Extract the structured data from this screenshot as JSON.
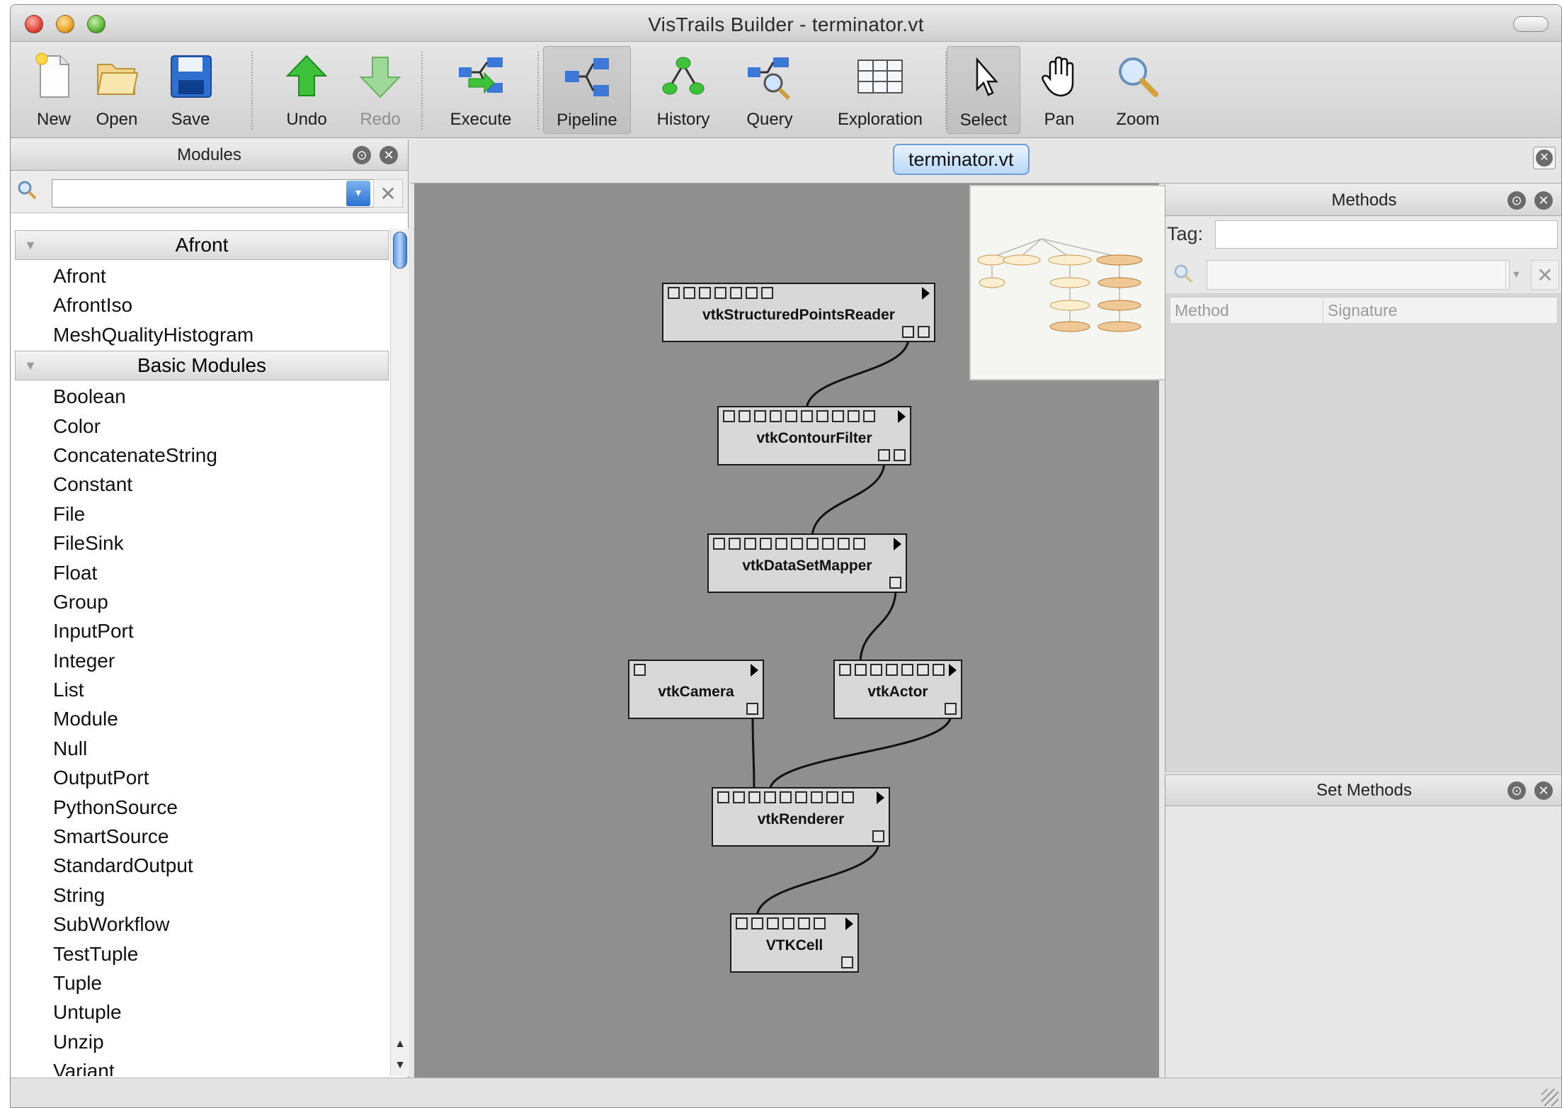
{
  "window": {
    "title": "VisTrails Builder - terminator.vt"
  },
  "toolbar": {
    "new": "New",
    "open": "Open",
    "save": "Save",
    "undo": "Undo",
    "redo": "Redo",
    "execute": "Execute",
    "pipeline": "Pipeline",
    "history": "History",
    "query": "Query",
    "exploration": "Exploration",
    "select": "Select",
    "pan": "Pan",
    "zoom": "Zoom",
    "active_view": "Pipeline",
    "disabled": [
      "Redo"
    ]
  },
  "modules_panel": {
    "title": "Modules",
    "search_value": "",
    "categories": [
      {
        "name": "Afront",
        "items": [
          "Afront",
          "AfrontIso",
          "MeshQualityHistogram"
        ]
      },
      {
        "name": "Basic Modules",
        "items": [
          "Boolean",
          "Color",
          "ConcatenateString",
          "Constant",
          "File",
          "FileSink",
          "Float",
          "Group",
          "InputPort",
          "Integer",
          "List",
          "Module",
          "Null",
          "OutputPort",
          "PythonSource",
          "SmartSource",
          "StandardOutput",
          "String",
          "SubWorkflow",
          "TestTuple",
          "Tuple",
          "Untuple",
          "Unzip",
          "Variant"
        ]
      }
    ]
  },
  "document_tab": {
    "label": "terminator.vt"
  },
  "pipeline": {
    "modules": [
      {
        "id": "m1",
        "name": "vtkStructuredPointsReader"
      },
      {
        "id": "m2",
        "name": "vtkContourFilter"
      },
      {
        "id": "m3",
        "name": "vtkDataSetMapper"
      },
      {
        "id": "m4",
        "name": "vtkCamera"
      },
      {
        "id": "m5",
        "name": "vtkActor"
      },
      {
        "id": "m6",
        "name": "vtkRenderer"
      },
      {
        "id": "m7",
        "name": "VTKCell"
      }
    ],
    "connections": [
      [
        "vtkStructuredPointsReader",
        "vtkContourFilter"
      ],
      [
        "vtkContourFilter",
        "vtkDataSetMapper"
      ],
      [
        "vtkDataSetMapper",
        "vtkActor"
      ],
      [
        "vtkCamera",
        "vtkRenderer"
      ],
      [
        "vtkActor",
        "vtkRenderer"
      ],
      [
        "vtkRenderer",
        "VTKCell"
      ]
    ]
  },
  "methods_panel": {
    "title": "Methods",
    "tag_label": "Tag:",
    "tag_value": "",
    "search_value": "",
    "columns": [
      "Method",
      "Signature"
    ]
  },
  "set_methods_panel": {
    "title": "Set Methods"
  },
  "colors": {
    "canvas_bg": "#8f8f8f",
    "module_fill": "#d8d8d8",
    "tab_highlight": "#b9d8f8",
    "minimap_node": "#f0c896"
  }
}
